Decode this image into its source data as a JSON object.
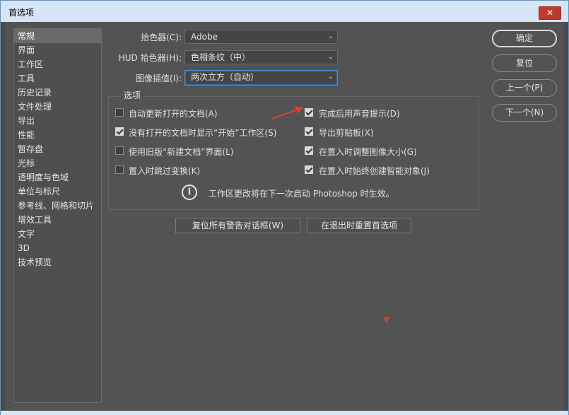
{
  "window": {
    "title": "首选项",
    "close_symbol": "✕"
  },
  "sidebar": {
    "items": [
      {
        "label": "常规"
      },
      {
        "label": "界面"
      },
      {
        "label": "工作区"
      },
      {
        "label": "工具"
      },
      {
        "label": "历史记录"
      },
      {
        "label": "文件处理"
      },
      {
        "label": "导出"
      },
      {
        "label": "性能"
      },
      {
        "label": "暂存盘"
      },
      {
        "label": "光标"
      },
      {
        "label": "透明度与色域"
      },
      {
        "label": "单位与标尺"
      },
      {
        "label": "参考线、网格和切片"
      },
      {
        "label": "增效工具"
      },
      {
        "label": "文字"
      },
      {
        "label": "3D"
      },
      {
        "label": "技术预览"
      }
    ],
    "selected_index": 0
  },
  "fields": {
    "color_picker": {
      "label": "拾色器(C):",
      "value": "Adobe"
    },
    "hud_color_picker": {
      "label": "HUD 拾色器(H):",
      "value": "色相条纹（中）"
    },
    "image_interpolation": {
      "label": "图像插值(I):",
      "value": "两次立方（自动）"
    }
  },
  "options": {
    "title": "选项",
    "left": [
      {
        "label": "自动更新打开的文档(A)",
        "checked": false
      },
      {
        "label": "没有打开的文档时显示“开始”工作区(S)",
        "checked": true
      },
      {
        "label": "使用旧版“新建文档”界面(L)",
        "checked": false
      },
      {
        "label": "置入时跳过变换(K)",
        "checked": false
      }
    ],
    "right": [
      {
        "label": "完成后用声音提示(D)",
        "checked": true
      },
      {
        "label": "导出剪贴板(X)",
        "checked": true
      },
      {
        "label": "在置入时调整图像大小(G)",
        "checked": true
      },
      {
        "label": "在置入时始终创建智能对象(J)",
        "checked": true
      }
    ],
    "info_icon_glyph": "i",
    "info_text": "工作区更改将在下一次启动 Photoshop 时生效。"
  },
  "bottom_buttons": {
    "reset_warnings": "复位所有警告对话框(W)",
    "reset_prefs": "在退出时重置首选项"
  },
  "side_buttons": {
    "ok": "确定",
    "reset": "复位",
    "prev": "上一个(P)",
    "next": "下一个(N)"
  },
  "colors": {
    "annotation_red": "#d9403a",
    "window_bg": "#535353",
    "titlebar": "#d6e5f5"
  }
}
